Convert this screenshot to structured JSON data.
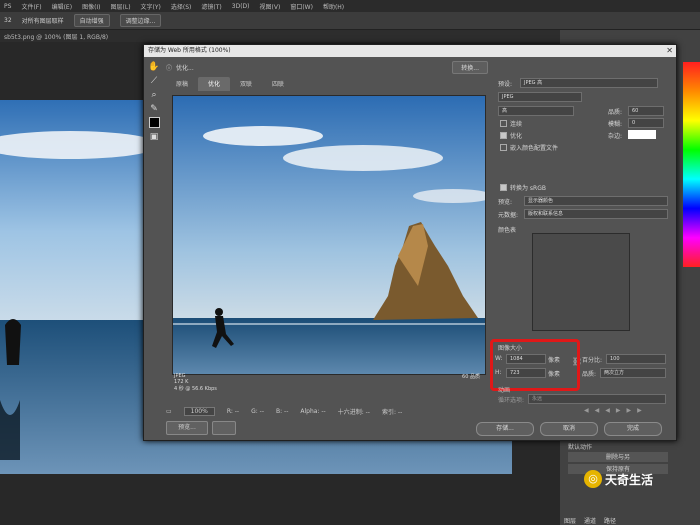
{
  "menu": [
    "PS",
    "文件(F)",
    "编辑(E)",
    "图像(I)",
    "图层(L)",
    "文字(Y)",
    "选择(S)",
    "滤镜(T)",
    "3D(D)",
    "视图(V)",
    "窗口(W)",
    "帮助(H)"
  ],
  "options": {
    "size_label": "32",
    "sample": "对所有图层取样",
    "auto": "自动增强",
    "refine": "调整边缘..."
  },
  "doc_tab": "sb5t3.png @ 100% (图层 1, RGB/8)",
  "dialog": {
    "title": "存储为 Web 所用格式 (100%)",
    "info_text": "优化...",
    "convert_btn": "转换...",
    "tabs": [
      "原稿",
      "优化",
      "双联",
      "四联"
    ],
    "preview_info": [
      "JPEG",
      "172 K",
      "4 秒 @ 56.6 Kbps"
    ],
    "preview_quality": "60 品质",
    "zoom": "100%",
    "r_label": "R: --",
    "g_label": "G: --",
    "b_label": "B: --",
    "alpha_label": "Alpha: --",
    "hex_label": "十六进制: --",
    "index_label": "索引: --",
    "preview_btn": "预览...",
    "preset_label": "预设:",
    "preset_value": "JPEG 高",
    "format": "JPEG",
    "quality_level": "高",
    "quality_label": "品质:",
    "quality_value": "60",
    "blur_label": "模糊:",
    "blur_value": "0",
    "matte_label": "杂边:",
    "progressive": "连续",
    "optimized": "优化",
    "embed_profile": "嵌入颜色配置文件",
    "convert_srgb": "转换为 sRGB",
    "preview_label": "预览:",
    "preview_value": "显示器颜色",
    "metadata_label": "元数据:",
    "metadata_value": "版权和联系信息",
    "color_table": "颜色表",
    "image_size": "图像大小",
    "w_label": "W:",
    "w_value": "1084",
    "h_label": "H:",
    "h_value": "723",
    "px": "像素",
    "percent_label": "百分比:",
    "percent_value": "100",
    "quality2_label": "品质:",
    "quality2_value": "两次立方",
    "animation": "动画",
    "loop_label": "循环选项:",
    "loop_value": "永远",
    "btn_save": "存储...",
    "btn_cancel": "取消",
    "btn_done": "完成"
  },
  "right_panel": {
    "actions_label": "默认动作",
    "btn1": "删除与另",
    "btn2": "保持原有",
    "bottom_tabs": [
      "图层",
      "通道",
      "路径"
    ]
  },
  "watermark": "天奇生活"
}
